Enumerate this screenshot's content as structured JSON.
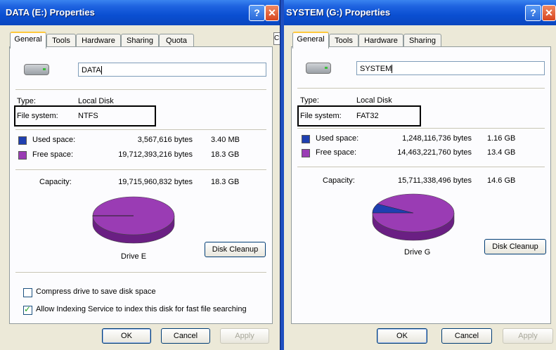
{
  "dialog_e": {
    "title": "DATA (E:) Properties",
    "tabs": [
      {
        "label": "General"
      },
      {
        "label": "Tools"
      },
      {
        "label": "Hardware"
      },
      {
        "label": "Sharing"
      },
      {
        "label": "Quota"
      }
    ],
    "name_value": "DATA",
    "type_label": "Type:",
    "type_value": "Local Disk",
    "fs_label": "File system:",
    "fs_value": "NTFS",
    "used_label": "Used space:",
    "used_bytes": "3,567,616 bytes",
    "used_size": "3.40 MB",
    "free_label": "Free space:",
    "free_bytes": "19,712,393,216 bytes",
    "free_size": "18.3 GB",
    "cap_label": "Capacity:",
    "cap_bytes": "19,715,960,832 bytes",
    "cap_size": "18.3 GB",
    "drive_caption": "Drive E",
    "used_fraction": 0.0002,
    "disk_cleanup": "Disk Cleanup",
    "compress_label": "Compress drive to save disk space",
    "compress_checked": false,
    "index_label": "Allow Indexing Service to index this disk for fast file searching",
    "index_checked": true,
    "ok": "OK",
    "cancel": "Cancel",
    "apply": "Apply",
    "help_glyph": "?",
    "close_glyph": "✕",
    "cropped_glyph": "C"
  },
  "dialog_g": {
    "title": "SYSTEM (G:) Properties",
    "tabs": [
      {
        "label": "General"
      },
      {
        "label": "Tools"
      },
      {
        "label": "Hardware"
      },
      {
        "label": "Sharing"
      }
    ],
    "name_value": "SYSTEM",
    "type_label": "Type:",
    "type_value": "Local Disk",
    "fs_label": "File system:",
    "fs_value": "FAT32",
    "used_label": "Used space:",
    "used_bytes": "1,248,116,736 bytes",
    "used_size": "1.16 GB",
    "free_label": "Free space:",
    "free_bytes": "14,463,221,760 bytes",
    "free_size": "13.4 GB",
    "cap_label": "Capacity:",
    "cap_bytes": "15,711,338,496 bytes",
    "cap_size": "14.6 GB",
    "drive_caption": "Drive G",
    "used_fraction": 0.079,
    "disk_cleanup": "Disk Cleanup",
    "ok": "OK",
    "cancel": "Cancel",
    "apply": "Apply",
    "help_glyph": "?",
    "close_glyph": "✕"
  },
  "colors": {
    "used": "#1f3fb0",
    "free": "#9a3cb4",
    "free_dark": "#6a1f83",
    "titlebar": "#0a4fd2"
  }
}
